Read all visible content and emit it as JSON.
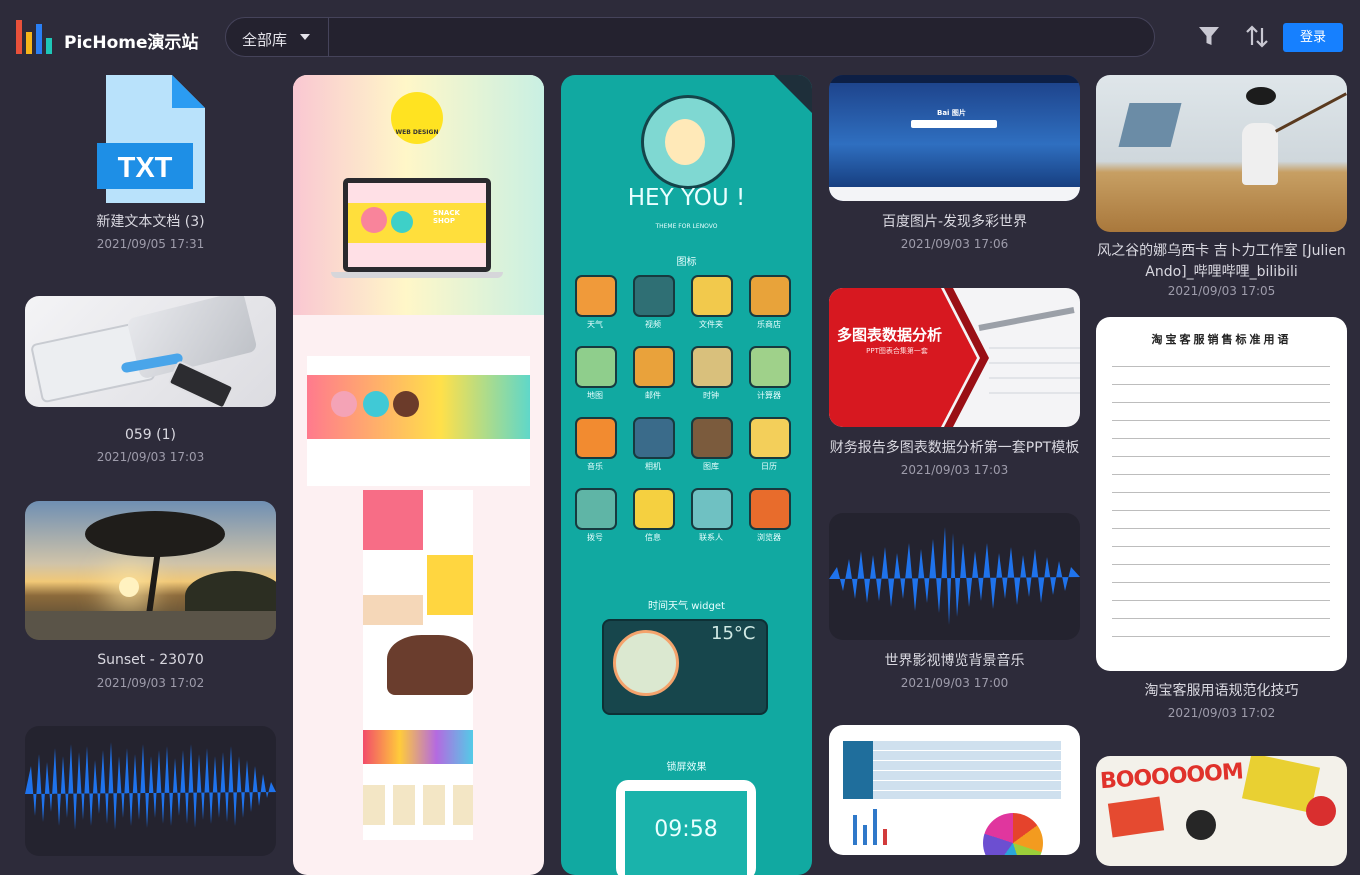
{
  "header": {
    "brand": "PicHome演示站",
    "scope_label": "全部库",
    "search_placeholder": "",
    "login_label": "登录",
    "icons": [
      "filter-icon",
      "sort-icon"
    ]
  },
  "colors": {
    "background": "#2d2b3a",
    "accent": "#1680ff",
    "logo": [
      "#e8513a",
      "#f6b51a",
      "#2a7ff4",
      "#1ec7b8"
    ]
  },
  "left_column": [
    {
      "title": "新建文本文档 (3)",
      "date": "2021/09/05 17:31",
      "badge": "TXT"
    },
    {
      "title": "059 (1)",
      "date": "2021/09/03 17:03"
    },
    {
      "title": "Sunset - 23070",
      "date": "2021/09/03 17:02"
    }
  ],
  "right_columns": [
    {
      "title": "百度图片-发现多彩世界",
      "date": "2021/09/03 17:06"
    },
    {
      "title": "财务报告多图表数据分析第一套PPT模板",
      "date": "2021/09/03 17:03"
    },
    {
      "title": "世界影视博览背景音乐",
      "date": "2021/09/03 17:00"
    },
    {
      "title": "风之谷的娜乌西卡 吉卜力工作室 [Julien Ando]_哔哩哔哩_bilibili",
      "date": "2021/09/03 17:05"
    },
    {
      "title": "淘宝客服用语规范化技巧",
      "date": "2021/09/03 17:02"
    }
  ],
  "thumbnail_text": {
    "web_badge": "WEB DESIGN",
    "snack": "SNACK SHOP",
    "hey_you": "HEY YOU !",
    "theme_for": "THEME FOR LENOVO",
    "icon_section": "图标",
    "app_labels": [
      "天气",
      "视频",
      "文件夹",
      "乐商店",
      "地图",
      "邮件",
      "时钟",
      "计算器",
      "音乐",
      "相机",
      "图库",
      "日历",
      "拨号",
      "信息",
      "联系人",
      "浏览器"
    ],
    "widget_title": "时间天气 widget",
    "widget_temp": "15°C",
    "lock_title": "锁屏效果",
    "lock_time": "09:58",
    "chart_headline": "多图表数据分析",
    "chart_sub": "PPT图表合集第一套",
    "doc_title": "淘宝客服销售标准用语",
    "baidu": "Bai 图片",
    "comic": "BOOOOOOM"
  }
}
